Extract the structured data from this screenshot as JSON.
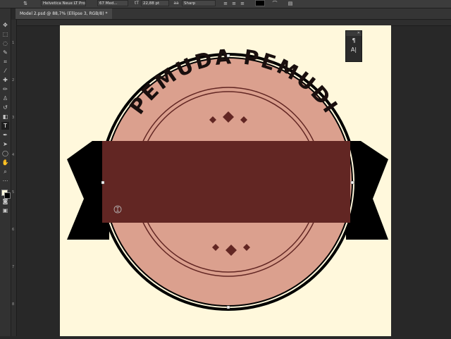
{
  "options_bar": {
    "font_family": "Helvetica Neue LT Pro",
    "font_style": "67 Med...",
    "font_size": "22,88 pt",
    "antialias": "Sharp"
  },
  "document_tab": {
    "label": "Model 2.psd @ 88,7% (Ellipse 3, RGB/8) *"
  },
  "rulers": {
    "vertical_ticks": [
      "1",
      "2",
      "3",
      "4",
      "5",
      "6",
      "7",
      "8"
    ]
  },
  "badge": {
    "arc_text": "PEMUDA PEMUDI"
  },
  "colors": {
    "canvas_bg": "#fff8dc",
    "badge_fill": "#dba08e",
    "ribbon_band": "#622623",
    "ribbon_tails": "#000000",
    "foreground": "#fff8dc",
    "background": "#000000"
  },
  "panel": {
    "icons": [
      "paragraph-icon",
      "character-icon"
    ]
  }
}
